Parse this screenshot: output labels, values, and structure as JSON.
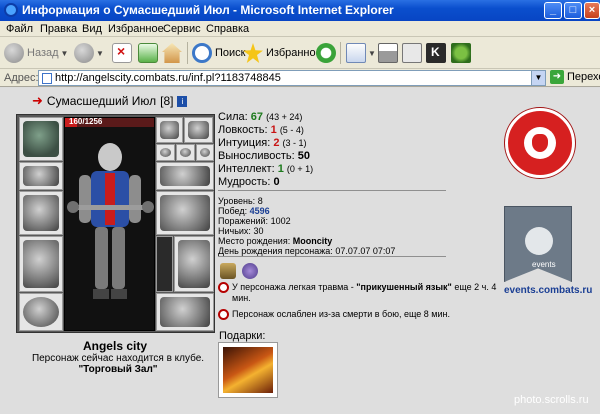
{
  "window": {
    "title": "Информация о Сумасшедший Июл - Microsoft Internet Explorer",
    "controls": {
      "minimize": "_",
      "maximize": "□",
      "close": "×"
    }
  },
  "menu": [
    "Файл",
    "Правка",
    "Вид",
    "Избранное",
    "Сервис",
    "Справка"
  ],
  "toolbar": {
    "back": "Назад",
    "search": "Поиск",
    "favorites": "Избранное",
    "icons": [
      "back-icon",
      "forward-icon",
      "stop-icon",
      "refresh-icon",
      "home-icon",
      "search-icon",
      "favorites-icon",
      "history-icon",
      "mail-icon",
      "print-icon",
      "edit-icon",
      "messenger-icon"
    ]
  },
  "address": {
    "label": "Адрес:",
    "url": "http://angelscity.combats.ru/inf.pl?1183748845",
    "go": "Переход"
  },
  "character": {
    "name": "Сумасшедший Июл",
    "level_tag": "[8]",
    "info_badge": "i",
    "hp_text": "160/1256",
    "hp_fraction": 0.127
  },
  "stats": [
    {
      "label": "Сила:",
      "value": "67",
      "mod": "(43 + 24)",
      "color": "green"
    },
    {
      "label": "Ловкость:",
      "value": "1",
      "mod": "(5 - 4)",
      "color": "red"
    },
    {
      "label": "Интуиция:",
      "value": "2",
      "mod": "(3 - 1)",
      "color": "red"
    },
    {
      "label": "Выносливость:",
      "value": "50",
      "mod": "",
      "color": "dark"
    },
    {
      "label": "Интеллект:",
      "value": "1",
      "mod": "(0 + 1)",
      "color": "green"
    },
    {
      "label": "Мудрость:",
      "value": "0",
      "mod": "",
      "color": "dark"
    }
  ],
  "details": {
    "level_label": "Уровень:",
    "level": "8",
    "wins_label": "Побед:",
    "wins": "4596",
    "losses_label": "Поражений:",
    "losses": "1002",
    "draws_label": "Ничьих:",
    "draws": "30",
    "birthplace_label": "Место рождения:",
    "birthplace": "Mooncity",
    "birthday_label": "День рождения персонажа:",
    "birthday": "07.07.07 07:07"
  },
  "notes": {
    "injury_prefix": "У персонажа легкая травма - ",
    "injury_name": "\"прикушенный язык\"",
    "injury_suffix": " еще 2 ч. 4 мин.",
    "weakened": "Персонаж ослаблен из-за смерти в бою, еще 8 мин."
  },
  "gifts": {
    "title": "Подарки:"
  },
  "location": {
    "city": "Angels city",
    "text": "Персонаж сейчас находится в клубе.",
    "room": "\"Торговый Зал\""
  },
  "events": {
    "banner_label": "events",
    "link": "events.combats.ru"
  },
  "watermark": "photo.scrolls.ru"
}
